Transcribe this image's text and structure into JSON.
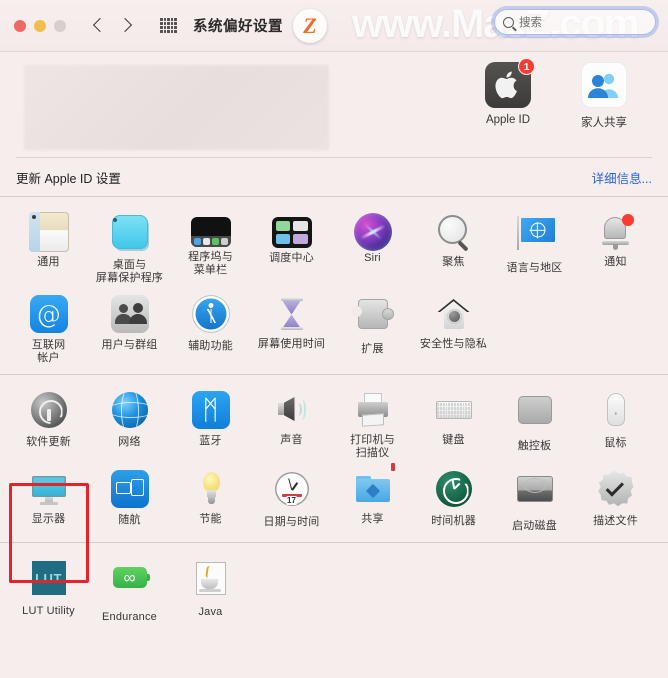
{
  "window": {
    "title": "系统偏好设置",
    "watermark": "www.MacZ.com",
    "logo_letter": "Z"
  },
  "toolbar": {
    "back_icon": "chevron-left-icon",
    "forward_icon": "chevron-right-icon",
    "grid_icon": "grid-view-icon",
    "search": {
      "placeholder": "搜索",
      "value": "",
      "icon": "search-icon"
    },
    "traffic_lights": {
      "close": "close-button",
      "minimize": "minimize-button",
      "zoom": "zoom-button"
    }
  },
  "appleid": {
    "items": [
      {
        "label": "Apple ID",
        "icon": "apple-logo-icon",
        "badge": "1"
      },
      {
        "label": "家人共享",
        "icon": "family-sharing-icon",
        "badge": ""
      }
    ],
    "update_text": "更新 Apple ID 设置",
    "detail_link": "详细信息..."
  },
  "sections": [
    {
      "name": "system-section",
      "rows": [
        [
          {
            "label": "通用",
            "label2": "",
            "icon": "general-icon"
          },
          {
            "label": "桌面与",
            "label2": "屏幕保护程序",
            "icon": "desktop-screensaver-icon"
          },
          {
            "label": "程序坞与",
            "label2": "菜单栏",
            "icon": "dock-menubar-icon"
          },
          {
            "label": "调度中心",
            "label2": "",
            "icon": "mission-control-icon"
          },
          {
            "label": "Siri",
            "label2": "",
            "icon": "siri-icon"
          },
          {
            "label": "聚焦",
            "label2": "",
            "icon": "spotlight-icon"
          },
          {
            "label": "语言与地区",
            "label2": "",
            "icon": "language-region-icon"
          },
          {
            "label": "通知",
            "label2": "",
            "icon": "notifications-icon"
          }
        ],
        [
          {
            "label": "互联网",
            "label2": "帐户",
            "icon": "internet-accounts-icon"
          },
          {
            "label": "用户与群组",
            "label2": "",
            "icon": "users-groups-icon"
          },
          {
            "label": "辅助功能",
            "label2": "",
            "icon": "accessibility-icon"
          },
          {
            "label": "屏幕使用时间",
            "label2": "",
            "icon": "screen-time-icon"
          },
          {
            "label": "扩展",
            "label2": "",
            "icon": "extensions-icon"
          },
          {
            "label": "安全性与隐私",
            "label2": "",
            "icon": "security-privacy-icon"
          }
        ]
      ]
    },
    {
      "name": "hardware-section",
      "rows": [
        [
          {
            "label": "软件更新",
            "label2": "",
            "icon": "software-update-icon"
          },
          {
            "label": "网络",
            "label2": "",
            "icon": "network-icon"
          },
          {
            "label": "蓝牙",
            "label2": "",
            "icon": "bluetooth-icon"
          },
          {
            "label": "声音",
            "label2": "",
            "icon": "sound-icon"
          },
          {
            "label": "打印机与",
            "label2": "扫描仪",
            "icon": "printers-scanners-icon"
          },
          {
            "label": "键盘",
            "label2": "",
            "icon": "keyboard-icon"
          },
          {
            "label": "触控板",
            "label2": "",
            "icon": "trackpad-icon"
          },
          {
            "label": "鼠标",
            "label2": "",
            "icon": "mouse-icon"
          }
        ],
        [
          {
            "label": "显示器",
            "label2": "",
            "icon": "displays-icon"
          },
          {
            "label": "随航",
            "label2": "",
            "icon": "sidecar-icon"
          },
          {
            "label": "节能",
            "label2": "",
            "icon": "energy-saver-icon"
          },
          {
            "label": "日期与时间",
            "label2": "",
            "icon": "date-time-icon"
          },
          {
            "label": "共享",
            "label2": "",
            "icon": "sharing-icon"
          },
          {
            "label": "时间机器",
            "label2": "",
            "icon": "time-machine-icon"
          },
          {
            "label": "启动磁盘",
            "label2": "",
            "icon": "startup-disk-icon"
          },
          {
            "label": "描述文件",
            "label2": "",
            "icon": "profiles-icon"
          }
        ]
      ]
    },
    {
      "name": "thirdparty-section",
      "rows": [
        [
          {
            "label": "LUT Utility",
            "label2": "",
            "icon": "lut-utility-icon"
          },
          {
            "label": "Endurance",
            "label2": "",
            "icon": "endurance-icon"
          },
          {
            "label": "Java",
            "label2": "",
            "icon": "java-icon"
          }
        ]
      ]
    }
  ],
  "annotation": {
    "highlight_target": "显示器",
    "color": "#e3242b"
  },
  "icon_text": {
    "lut": "LUT",
    "at": "@",
    "bluetooth": "ᛗ",
    "infinity": "∞",
    "clock_date": "17"
  }
}
